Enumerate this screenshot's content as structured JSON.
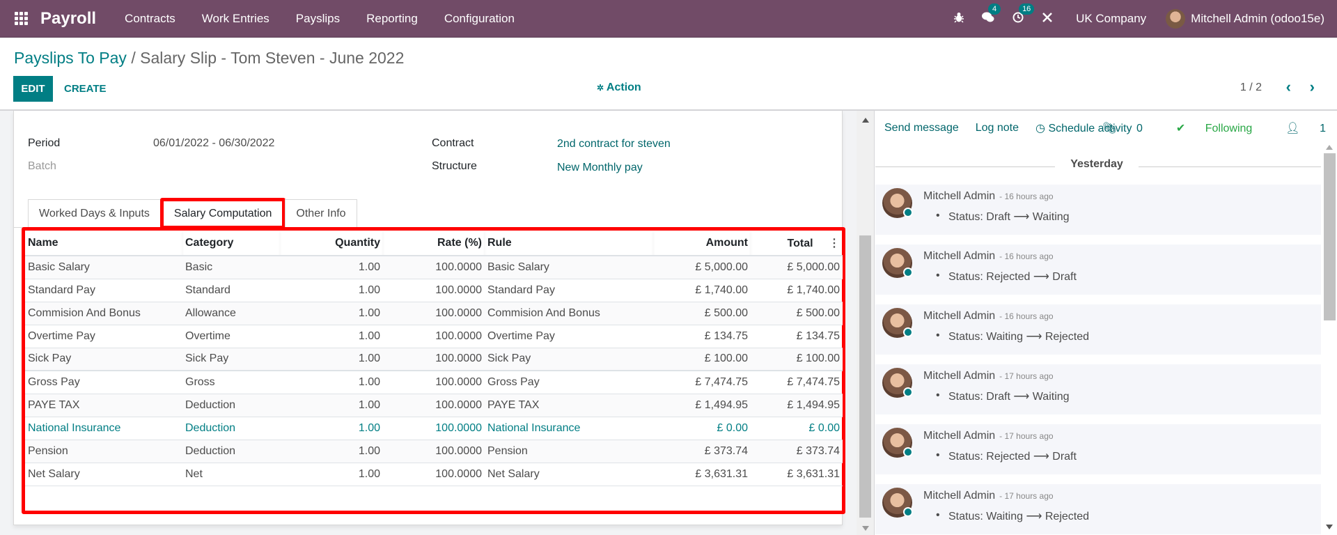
{
  "navbar": {
    "app_name": "Payroll",
    "menu": [
      "Contracts",
      "Work Entries",
      "Payslips",
      "Reporting",
      "Configuration"
    ],
    "icons": {
      "debug": "bug-icon",
      "messages": "chat-icon",
      "activities": "clock-icon",
      "tools": "tools-icon"
    },
    "messages_count": "4",
    "activities_count": "16",
    "company": "UK Company",
    "user": "Mitchell Admin (odoo15e)"
  },
  "breadcrumb": {
    "parent": "Payslips To Pay",
    "separator": "/",
    "current": "Salary Slip - Tom Steven - June 2022"
  },
  "control_panel": {
    "edit_label": "EDIT",
    "create_label": "CREATE",
    "action_label": "Action",
    "pager": "1 / 2"
  },
  "form": {
    "period_label": "Period",
    "period_value": "06/01/2022 - 06/30/2022",
    "batch_label": "Batch",
    "contract_label": "Contract",
    "contract_value": "2nd contract for steven",
    "structure_label": "Structure",
    "structure_value": "New Monthly pay"
  },
  "tabs": [
    {
      "label": "Worked Days & Inputs",
      "active": false
    },
    {
      "label": "Salary Computation",
      "active": true
    },
    {
      "label": "Other Info",
      "active": false
    }
  ],
  "salary_table": {
    "columns": [
      "Name",
      "Category",
      "Quantity",
      "Rate (%)",
      "Rule",
      "Amount",
      "Total"
    ],
    "rows": [
      {
        "name": "Basic Salary",
        "category": "Basic",
        "quantity": "1.00",
        "rate": "100.0000",
        "rule": "Basic Salary",
        "amount": "£ 5,000.00",
        "total": "£ 5,000.00"
      },
      {
        "name": "Standard Pay",
        "category": "Standard",
        "quantity": "1.00",
        "rate": "100.0000",
        "rule": "Standard Pay",
        "amount": "£ 1,740.00",
        "total": "£ 1,740.00"
      },
      {
        "name": "Commision And Bonus",
        "category": "Allowance",
        "quantity": "1.00",
        "rate": "100.0000",
        "rule": "Commision And Bonus",
        "amount": "£ 500.00",
        "total": "£ 500.00"
      },
      {
        "name": "Overtime Pay",
        "category": "Overtime",
        "quantity": "1.00",
        "rate": "100.0000",
        "rule": "Overtime Pay",
        "amount": "£ 134.75",
        "total": "£ 134.75"
      },
      {
        "name": "Sick Pay",
        "category": "Sick Pay",
        "quantity": "1.00",
        "rate": "100.0000",
        "rule": "Sick Pay",
        "amount": "£ 100.00",
        "total": "£ 100.00"
      },
      {
        "name": "Gross Pay",
        "category": "Gross",
        "quantity": "1.00",
        "rate": "100.0000",
        "rule": "Gross Pay",
        "amount": "£ 7,474.75",
        "total": "£ 7,474.75"
      },
      {
        "name": "PAYE TAX",
        "category": "Deduction",
        "quantity": "1.00",
        "rate": "100.0000",
        "rule": "PAYE TAX",
        "amount": "£ 1,494.95",
        "total": "£ 1,494.95"
      },
      {
        "name": "National Insurance",
        "category": "Deduction",
        "quantity": "1.00",
        "rate": "100.0000",
        "rule": "National Insurance",
        "amount": "£ 0.00",
        "total": "£ 0.00"
      },
      {
        "name": "Pension",
        "category": "Deduction",
        "quantity": "1.00",
        "rate": "100.0000",
        "rule": "Pension",
        "amount": "£ 373.74",
        "total": "£ 373.74"
      },
      {
        "name": "Net Salary",
        "category": "Net",
        "quantity": "1.00",
        "rate": "100.0000",
        "rule": "Net Salary",
        "amount": "£ 3,631.31",
        "total": "£ 3,631.31"
      }
    ]
  },
  "chatter": {
    "send_message": "Send message",
    "log_note": "Log note",
    "schedule_activity": "Schedule activity",
    "attachments_count": "0",
    "following": "Following",
    "followers_count": "1",
    "day_separator": "Yesterday",
    "messages": [
      {
        "author": "Mitchell Admin",
        "time": "- 16 hours ago",
        "from": "Draft",
        "to": "Waiting"
      },
      {
        "author": "Mitchell Admin",
        "time": "- 16 hours ago",
        "from": "Rejected",
        "to": "Draft"
      },
      {
        "author": "Mitchell Admin",
        "time": "- 16 hours ago",
        "from": "Waiting",
        "to": "Rejected"
      },
      {
        "author": "Mitchell Admin",
        "time": "- 17 hours ago",
        "from": "Draft",
        "to": "Waiting"
      },
      {
        "author": "Mitchell Admin",
        "time": "- 17 hours ago",
        "from": "Rejected",
        "to": "Draft"
      },
      {
        "author": "Mitchell Admin",
        "time": "- 17 hours ago",
        "from": "Waiting",
        "to": "Rejected"
      }
    ],
    "status_prefix": "Status:",
    "arrow": "⟶"
  },
  "colors": {
    "navbar": "#714b67",
    "primary": "#017e84",
    "highlight": "#ff0000",
    "following": "#28a745"
  }
}
